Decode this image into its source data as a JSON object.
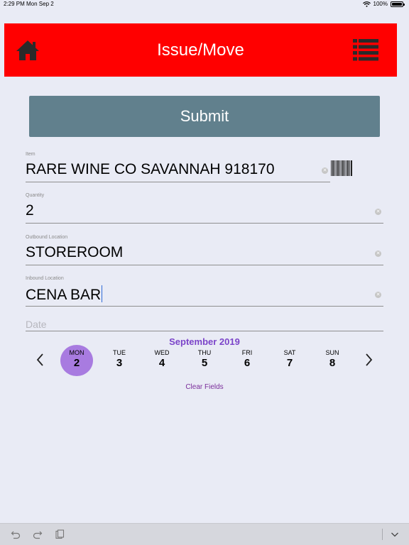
{
  "status_bar": {
    "time": "2:29 PM",
    "date": "Mon Sep 2",
    "battery": "100%"
  },
  "header": {
    "title": "Issue/Move",
    "home_icon": "home-icon",
    "menu_icon": "list-icon",
    "color": "#ff0000"
  },
  "submit": {
    "label": "Submit",
    "color": "#61808d"
  },
  "fields": {
    "item": {
      "label": "Item",
      "value": "RARE WINE CO SAVANNAH 918170"
    },
    "quantity": {
      "label": "Quantity",
      "value": "2"
    },
    "outbound": {
      "label": "Outbound Location",
      "value": "STOREROOM"
    },
    "inbound": {
      "label": "Inbound Location",
      "value": "CENA BAR"
    },
    "date": {
      "placeholder": "Date"
    }
  },
  "calendar": {
    "month": "September 2019",
    "accent": "#7b44c9",
    "days": [
      {
        "dow": "MON",
        "num": "2",
        "selected": true
      },
      {
        "dow": "TUE",
        "num": "3"
      },
      {
        "dow": "WED",
        "num": "4"
      },
      {
        "dow": "THU",
        "num": "5"
      },
      {
        "dow": "FRI",
        "num": "6"
      },
      {
        "dow": "SAT",
        "num": "7"
      },
      {
        "dow": "SUN",
        "num": "8"
      }
    ]
  },
  "clear_fields": {
    "label": "Clear Fields"
  },
  "toolbar": {
    "undo_icon": "undo-icon",
    "redo_icon": "redo-icon",
    "paste_icon": "paste-icon",
    "dismiss_icon": "chevron-down-icon"
  }
}
